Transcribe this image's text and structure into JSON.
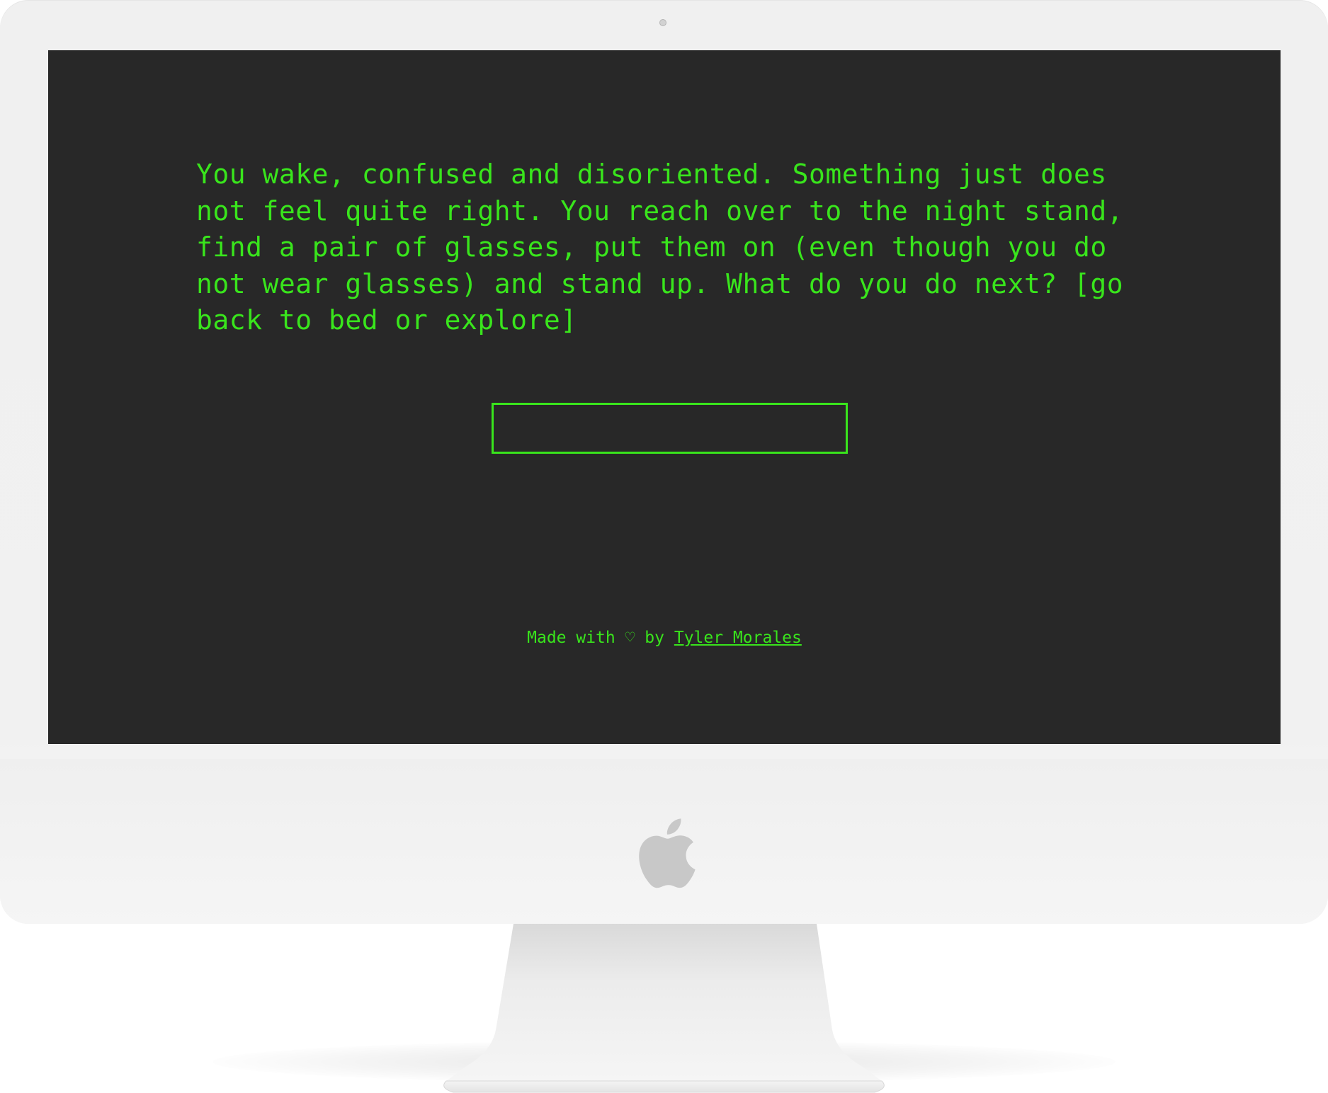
{
  "story": {
    "text": "You wake, confused and disoriented. Something just does\nnot feel quite right. You reach over to the night stand,\nfind a pair of glasses, put them on (even though you do\nnot wear glasses) and stand up. What do you do next? [go\nback to bed or explore]"
  },
  "answer": {
    "value": "",
    "placeholder": ""
  },
  "footer": {
    "made_with": "Made with ♡ by ",
    "author_link": "Tyler Morales"
  },
  "theme": {
    "screen_bg": "#282828",
    "accent": "#39e51c",
    "bezel": "#f0f0f0"
  },
  "icons": {
    "logo": "apple-logo-icon",
    "camera": "camera-icon"
  }
}
